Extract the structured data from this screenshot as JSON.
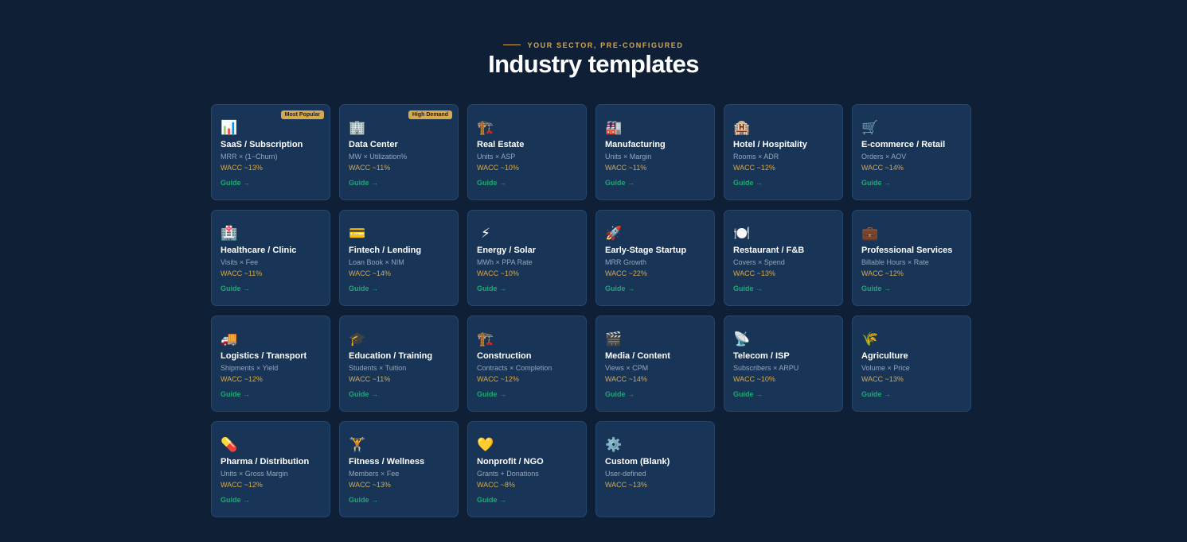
{
  "header": {
    "eyebrow": "YOUR SECTOR, PRE-CONFIGURED",
    "title": "Industry templates"
  },
  "cards": [
    {
      "name": "SaaS / Subscription",
      "formula": "MRR × (1−Churn)",
      "wacc": "WACC ~13%",
      "guide": "Guide →",
      "icon": "📊",
      "icon_name": "bar-chart-icon",
      "badge": "Most Popular"
    },
    {
      "name": "Data Center",
      "formula": "MW × Utilization%",
      "wacc": "WACC ~11%",
      "guide": "Guide →",
      "icon": "🏢",
      "icon_name": "office-building-icon",
      "badge": "High Demand"
    },
    {
      "name": "Real Estate",
      "formula": "Units × ASP",
      "wacc": "WACC ~10%",
      "guide": "Guide →",
      "icon": "🏗️",
      "icon_name": "construction-crane-icon"
    },
    {
      "name": "Manufacturing",
      "formula": "Units × Margin",
      "wacc": "WACC ~11%",
      "guide": "Guide →",
      "icon": "🏭",
      "icon_name": "factory-icon"
    },
    {
      "name": "Hotel / Hospitality",
      "formula": "Rooms × ADR",
      "wacc": "WACC ~12%",
      "guide": "Guide →",
      "icon": "🏨",
      "icon_name": "hotel-icon"
    },
    {
      "name": "E-commerce / Retail",
      "formula": "Orders × AOV",
      "wacc": "WACC ~14%",
      "guide": "Guide →",
      "icon": "🛒",
      "icon_name": "shopping-cart-icon"
    },
    {
      "name": "Healthcare / Clinic",
      "formula": "Visits × Fee",
      "wacc": "WACC ~11%",
      "guide": "Guide →",
      "icon": "🏥",
      "icon_name": "hospital-icon"
    },
    {
      "name": "Fintech / Lending",
      "formula": "Loan Book × NIM",
      "wacc": "WACC ~14%",
      "guide": "Guide →",
      "icon": "💳",
      "icon_name": "credit-card-icon"
    },
    {
      "name": "Energy / Solar",
      "formula": "MWh × PPA Rate",
      "wacc": "WACC ~10%",
      "guide": "Guide →",
      "icon": "⚡",
      "icon_name": "lightning-icon"
    },
    {
      "name": "Early-Stage Startup",
      "formula": "MRR Growth",
      "wacc": "WACC ~22%",
      "guide": "Guide →",
      "icon": "🚀",
      "icon_name": "rocket-icon"
    },
    {
      "name": "Restaurant / F&B",
      "formula": "Covers × Spend",
      "wacc": "WACC ~13%",
      "guide": "Guide →",
      "icon": "🍽️",
      "icon_name": "plate-icon"
    },
    {
      "name": "Professional Services",
      "formula": "Billable Hours × Rate",
      "wacc": "WACC ~12%",
      "guide": "Guide →",
      "icon": "💼",
      "icon_name": "briefcase-icon"
    },
    {
      "name": "Logistics / Transport",
      "formula": "Shipments × Yield",
      "wacc": "WACC ~12%",
      "guide": "Guide →",
      "icon": "🚚",
      "icon_name": "truck-icon"
    },
    {
      "name": "Education / Training",
      "formula": "Students × Tuition",
      "wacc": "WACC ~11%",
      "guide": "Guide →",
      "icon": "🎓",
      "icon_name": "graduation-cap-icon"
    },
    {
      "name": "Construction",
      "formula": "Contracts × Completion",
      "wacc": "WACC ~12%",
      "guide": "Guide →",
      "icon": "🏗️",
      "icon_name": "construction-crane-icon"
    },
    {
      "name": "Media / Content",
      "formula": "Views × CPM",
      "wacc": "WACC ~14%",
      "guide": "Guide →",
      "icon": "🎬",
      "icon_name": "clapperboard-icon"
    },
    {
      "name": "Telecom / ISP",
      "formula": "Subscribers × ARPU",
      "wacc": "WACC ~10%",
      "guide": "Guide →",
      "icon": "📡",
      "icon_name": "satellite-dish-icon"
    },
    {
      "name": "Agriculture",
      "formula": "Volume × Price",
      "wacc": "WACC ~13%",
      "guide": "Guide →",
      "icon": "🌾",
      "icon_name": "wheat-icon"
    },
    {
      "name": "Pharma / Distribution",
      "formula": "Units × Gross Margin",
      "wacc": "WACC ~12%",
      "guide": "Guide →",
      "icon": "💊",
      "icon_name": "pill-icon"
    },
    {
      "name": "Fitness / Wellness",
      "formula": "Members × Fee",
      "wacc": "WACC ~13%",
      "guide": "Guide →",
      "icon": "🏋️",
      "icon_name": "weightlifter-icon"
    },
    {
      "name": "Nonprofit / NGO",
      "formula": "Grants + Donations",
      "wacc": "WACC ~8%",
      "guide": "Guide →",
      "icon": "💛",
      "icon_name": "heart-icon"
    },
    {
      "name": "Custom (Blank)",
      "formula": "User-defined",
      "wacc": "WACC ~13%",
      "guide": "",
      "icon": "⚙️",
      "icon_name": "gear-icon"
    }
  ],
  "colors": {
    "background": "#0f1f35",
    "card": "#183558",
    "accent_gold": "#d6a94e",
    "guide_green": "#1fa873"
  }
}
